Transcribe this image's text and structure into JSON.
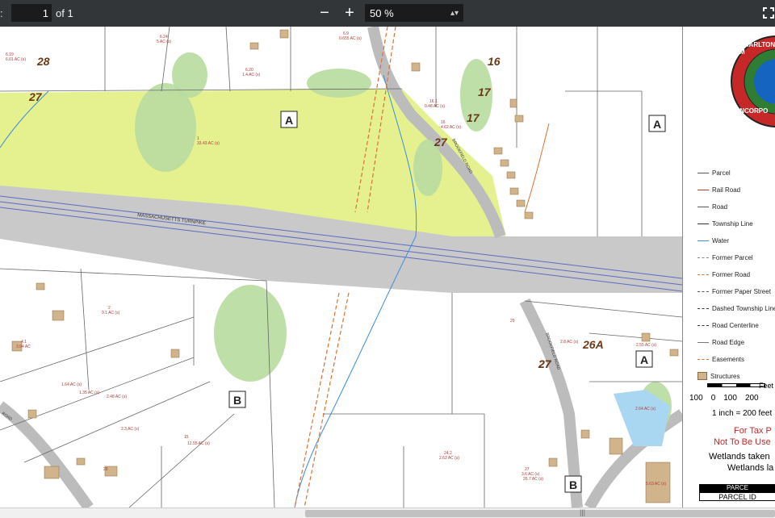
{
  "toolbar": {
    "page_prefix": ":",
    "page_value": "1",
    "page_of": "of 1",
    "zoom_out": "−",
    "zoom_in": "+",
    "zoom_value": "50 %",
    "zoom_arrow": "⇕",
    "fit_icon": "fit-page-icon"
  },
  "map": {
    "section_labels": [
      "A",
      "A",
      "A",
      "B",
      "B"
    ],
    "big_numbers": [
      "28",
      "27",
      "27",
      "16",
      "17",
      "17",
      "27",
      "26A",
      "27"
    ],
    "road_labels": [
      "MASSACHUSETTS TURNPIKE",
      "BROOKFIELD ROAD",
      "BROOKFIELD ROAD",
      "ROAD"
    ],
    "parcel_notes": [
      "6.19",
      "6.01 AC (s)",
      "6.24",
      "5 AC (s)",
      "6.20",
      "1.4 AC (s)",
      "6.9",
      "0.655 AC (s)",
      "1",
      "33.43 AC (s)",
      "16.1",
      "0.48 AC (s)",
      "16",
      "4.62 AC (s)",
      "2",
      "9.1 AC (s)",
      "4.1",
      "3.94 AC",
      "1.64 AC (s)",
      "1.35 AC (s)",
      "2.48 AC (s)",
      "2.3 AC (s)",
      "15",
      "12.55 AC (s)",
      "28",
      "29",
      "2.8 AC (s)",
      "2.55 AC (s)",
      "24.2",
      "2.62 AC (s)",
      "27",
      "3.6 AC (s)",
      "26.7 AC (s)",
      "2.64 AC (s)",
      "5.63 AC (s)"
    ]
  },
  "legend": {
    "seal_text": "CHARLTON, M",
    "seal_text2": "INCORPO",
    "items": [
      {
        "label": "Parcel",
        "color": "#555555",
        "style": "solid"
      },
      {
        "label": "Rail Road",
        "color": "#c0392b",
        "style": "solid"
      },
      {
        "label": "Road",
        "color": "#555555",
        "style": "solid"
      },
      {
        "label": "Township Line",
        "color": "#333333",
        "style": "solid"
      },
      {
        "label": "Water",
        "color": "#3a8fd9",
        "style": "solid"
      },
      {
        "label": "Former Parcel",
        "color": "#888888",
        "style": "dashed"
      },
      {
        "label": "Former Road",
        "color": "#e07030",
        "style": "dashed"
      },
      {
        "label": "Former Paper Street",
        "color": "#555555",
        "style": "dashed"
      },
      {
        "label": "Dashed Township Line",
        "color": "#333333",
        "style": "dashed"
      },
      {
        "label": "Road Centerline",
        "color": "#333333",
        "style": "dashed"
      },
      {
        "label": "Road Edge",
        "color": "#777777",
        "style": "solid"
      },
      {
        "label": "Easements",
        "color": "#e07030",
        "style": "dashed"
      },
      {
        "label": "Structures",
        "color": "#d2b48c",
        "style": "box"
      }
    ],
    "scale_feet": "Feet",
    "scale_ticks": [
      "100",
      "0",
      "100",
      "200"
    ],
    "scale_note": "1 inch = 200 feet",
    "warning1": "For Tax P",
    "warning2": "Not To Be Use",
    "wetlands1": "Wetlands taken",
    "wetlands2": "Wetlands la",
    "table_title": "PARCE",
    "table_header": "PARCEL ID"
  }
}
